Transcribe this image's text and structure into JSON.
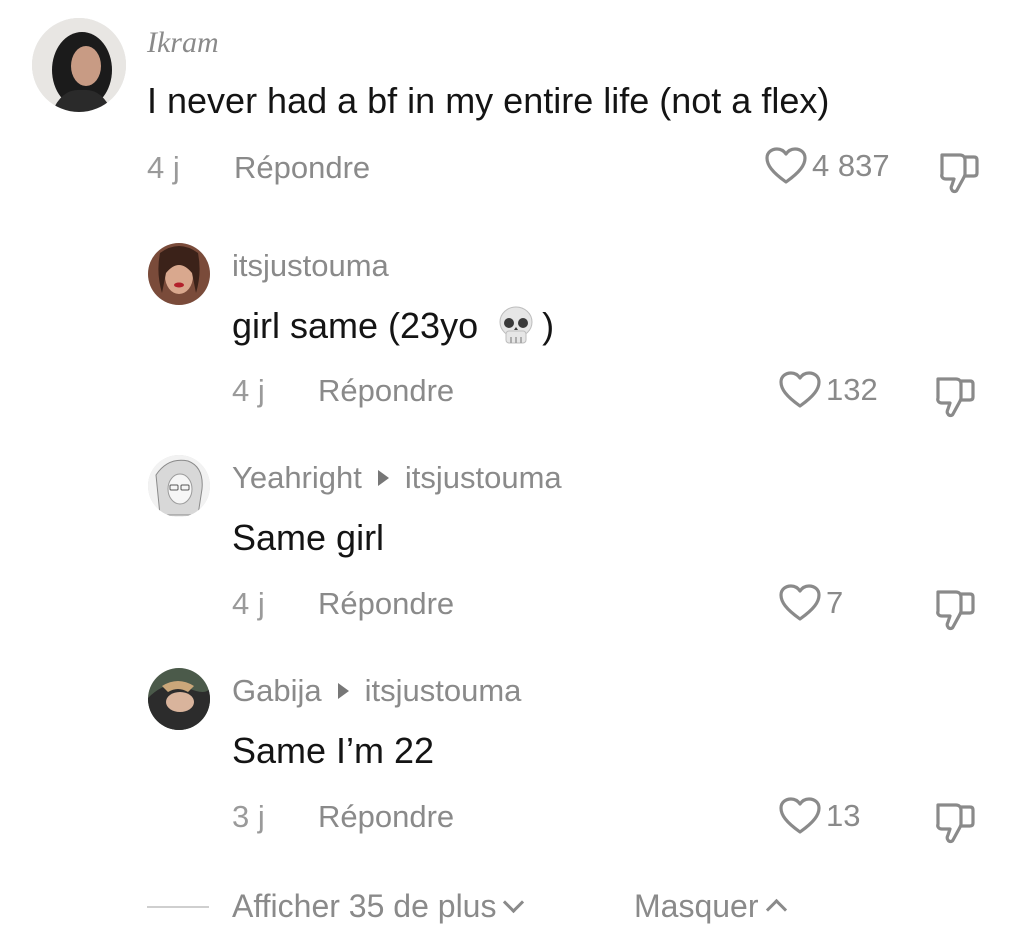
{
  "comments": [
    {
      "username": "Ikram",
      "text": "I never had a bf in my entire life (not a flex)",
      "age": "4 j",
      "reply_label": "Répondre",
      "likes": "4 837"
    },
    {
      "username": "itsjustouma",
      "text_before": "girl same (23yo",
      "text_after": ")",
      "emoji": "skull-emoji",
      "age": "4 j",
      "reply_label": "Répondre",
      "likes": "132"
    },
    {
      "username": "Yeahright",
      "reply_to": "itsjustouma",
      "text": "Same girl",
      "age": "4 j",
      "reply_label": "Répondre",
      "likes": "7"
    },
    {
      "username": "Gabija",
      "reply_to": "itsjustouma",
      "text": "Same I’m 22",
      "age": "3 j",
      "reply_label": "Répondre",
      "likes": "13"
    }
  ],
  "footer": {
    "show_more": "Afficher 35 de plus",
    "hide": "Masquer"
  },
  "colors": {
    "muted_text": "#8a8a8a",
    "main_text": "#141414",
    "background": "#ffffff"
  }
}
